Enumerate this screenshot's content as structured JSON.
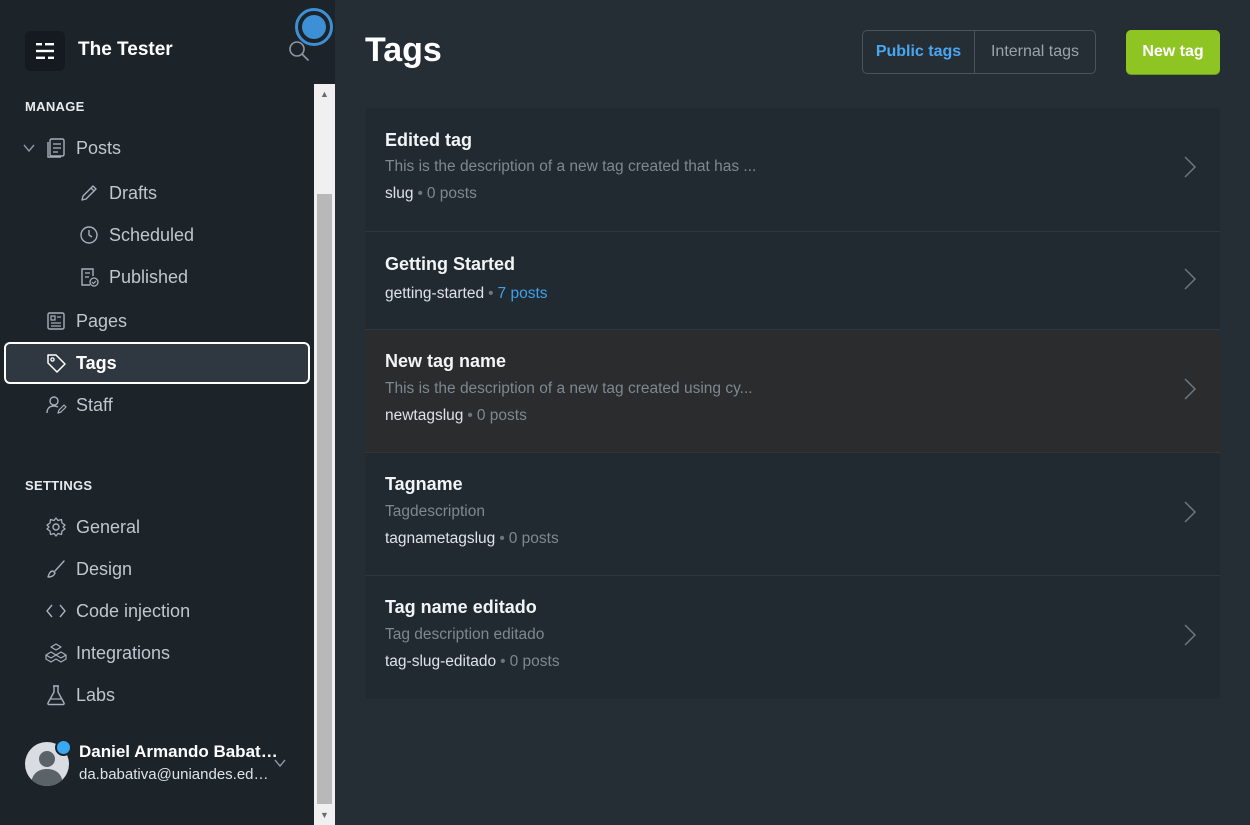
{
  "site": {
    "title": "The Tester"
  },
  "sidebar": {
    "manage_label": "MANAGE",
    "settings_label": "SETTINGS",
    "manage_items": [
      {
        "label": "Posts",
        "icon": "posts-icon"
      },
      {
        "label": "Drafts",
        "icon": "pencil-icon"
      },
      {
        "label": "Scheduled",
        "icon": "clock-icon"
      },
      {
        "label": "Published",
        "icon": "published-icon"
      },
      {
        "label": "Pages",
        "icon": "pages-icon"
      },
      {
        "label": "Tags",
        "icon": "tag-icon",
        "active": true
      },
      {
        "label": "Staff",
        "icon": "staff-icon"
      }
    ],
    "settings_items": [
      {
        "label": "General",
        "icon": "gear-icon"
      },
      {
        "label": "Design",
        "icon": "brush-icon"
      },
      {
        "label": "Code injection",
        "icon": "code-icon"
      },
      {
        "label": "Integrations",
        "icon": "integrations-icon"
      },
      {
        "label": "Labs",
        "icon": "flask-icon"
      }
    ]
  },
  "user": {
    "name": "Daniel Armando Babativa",
    "email": "da.babativa@uniandes.edu.co"
  },
  "header": {
    "title": "Tags",
    "public_tab": "Public tags",
    "internal_tab": "Internal tags",
    "new_button": "New tag"
  },
  "tags": [
    {
      "name": "Edited tag",
      "description": "This is the description of a new tag created that has ...",
      "slug": "slug",
      "separator": "•",
      "count": "0 posts"
    },
    {
      "name": "Getting Started",
      "description": "",
      "slug": "getting-started",
      "separator": "•",
      "count": "7 posts"
    },
    {
      "name": "New tag name",
      "description": "This is the description of a new tag created using cy...",
      "slug": "newtagslug",
      "separator": "•",
      "count": "0 posts"
    },
    {
      "name": "Tagname",
      "description": "Tagdescription",
      "slug": "tagnametagslug",
      "separator": "•",
      "count": "0 posts"
    },
    {
      "name": "Tag name editado",
      "description": "Tag description editado",
      "slug": "tag-slug-editado",
      "separator": "•",
      "count": "0 posts"
    }
  ],
  "colors": {
    "accent": "#3ea0ea",
    "primary_button": "#8fc523",
    "sidebar_bg": "#1c2329",
    "main_bg": "#262e35"
  }
}
